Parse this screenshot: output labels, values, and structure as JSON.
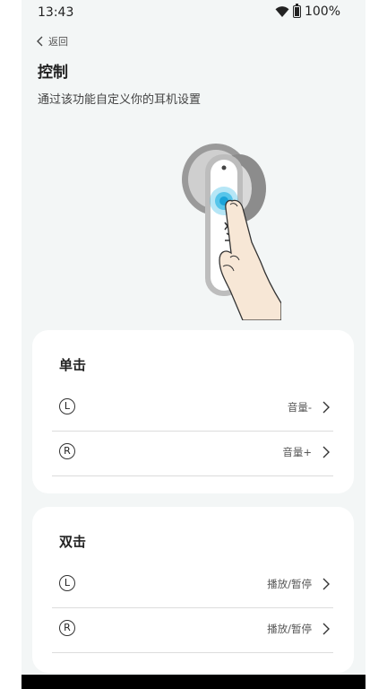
{
  "status": {
    "time": "13:43",
    "battery": "100%"
  },
  "header": {
    "back_label": "返回",
    "title": "控制",
    "subtitle": "通过该功能自定义你的耳机设置"
  },
  "sections": [
    {
      "title": "单击",
      "rows": [
        {
          "side": "L",
          "value": "音量-"
        },
        {
          "side": "R",
          "value": "音量+"
        }
      ]
    },
    {
      "title": "双击",
      "rows": [
        {
          "side": "L",
          "value": "播放/暂停"
        },
        {
          "side": "R",
          "value": "播放/暂停"
        }
      ]
    }
  ],
  "colors": {
    "background": "#f3f6f6",
    "card": "#ffffff",
    "accent_touch": "#2fb7e6"
  }
}
